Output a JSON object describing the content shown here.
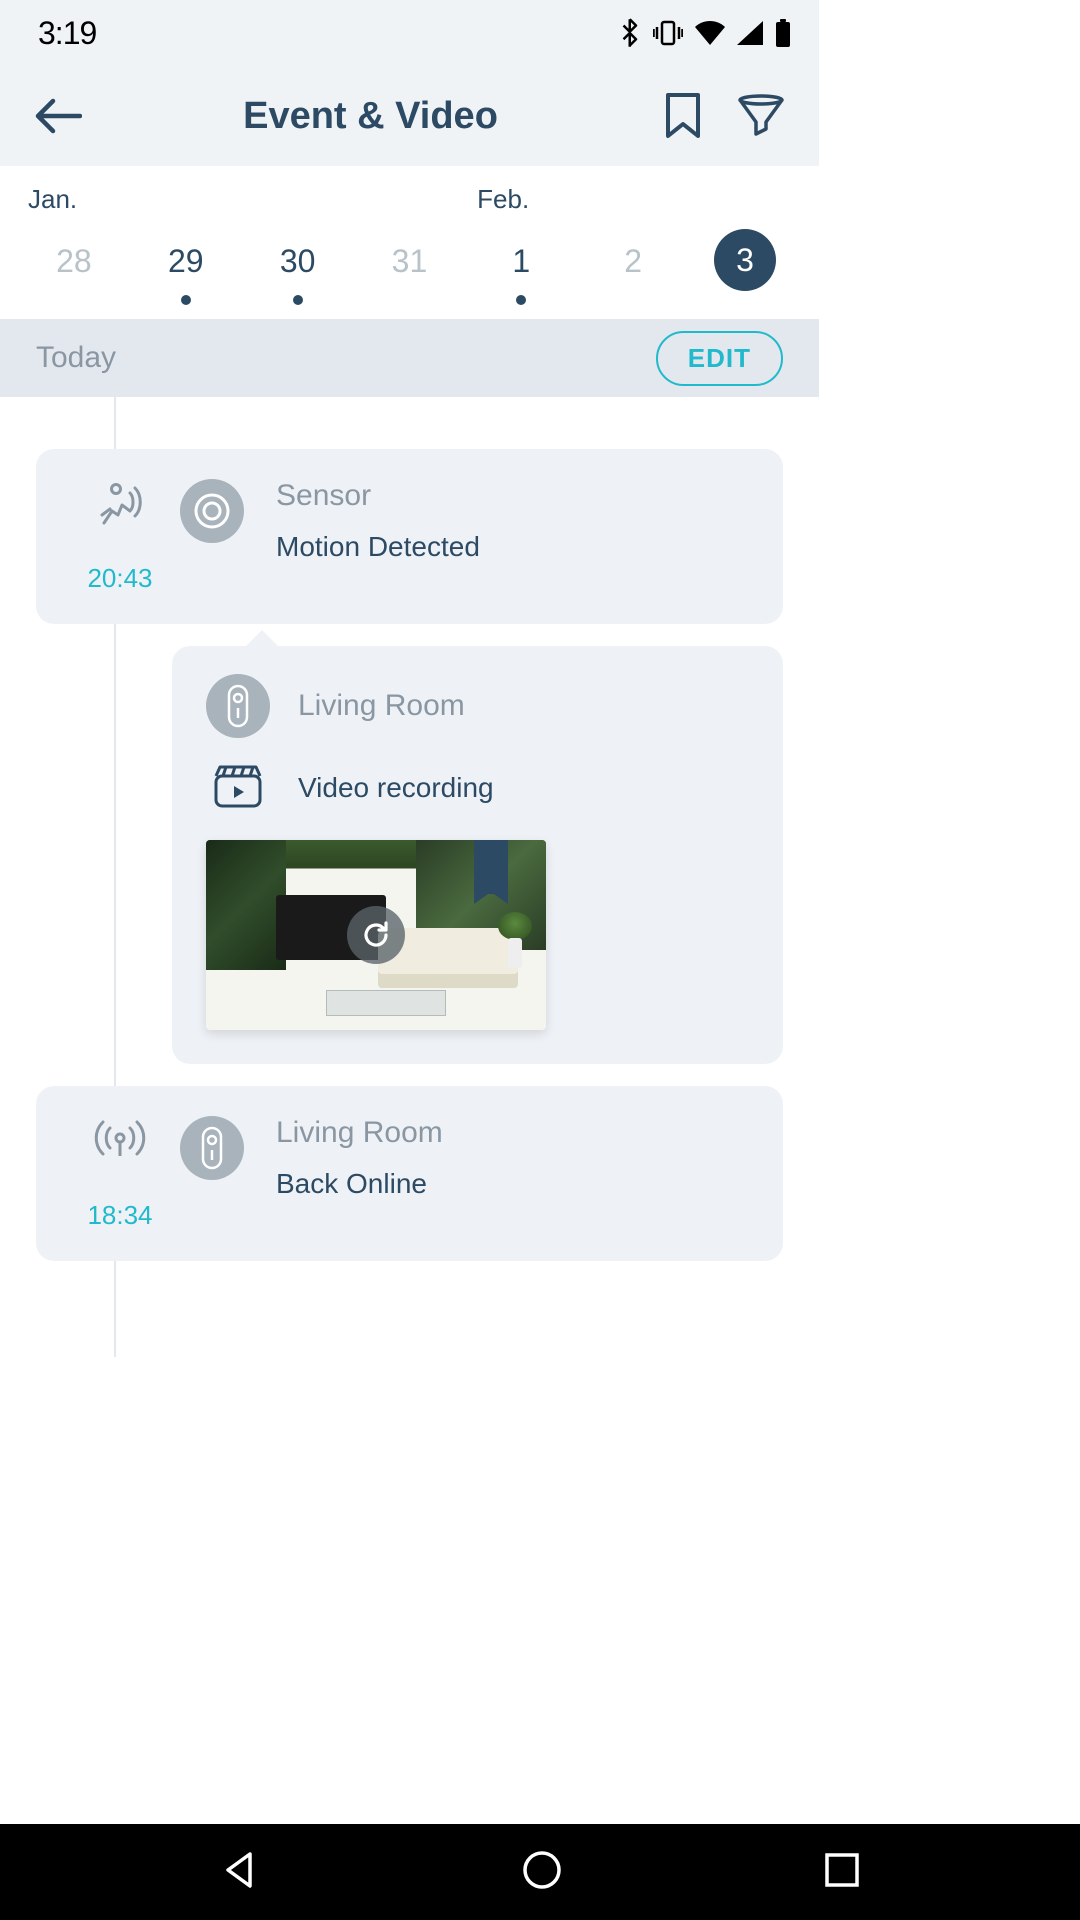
{
  "statusbar": {
    "time": "3:19"
  },
  "header": {
    "title": "Event & Video"
  },
  "calendar": {
    "months": [
      "Jan.",
      "Feb."
    ],
    "days": [
      {
        "num": "28",
        "faded": true,
        "dot": false,
        "selected": false
      },
      {
        "num": "29",
        "faded": false,
        "dot": true,
        "selected": false
      },
      {
        "num": "30",
        "faded": false,
        "dot": true,
        "selected": false
      },
      {
        "num": "31",
        "faded": true,
        "dot": false,
        "selected": false
      },
      {
        "num": "1",
        "faded": false,
        "dot": true,
        "selected": false
      },
      {
        "num": "2",
        "faded": true,
        "dot": false,
        "selected": false
      },
      {
        "num": "3",
        "faded": false,
        "dot": false,
        "selected": true
      }
    ]
  },
  "section": {
    "title": "Today",
    "edit": "EDIT"
  },
  "events": [
    {
      "kind": "motion",
      "time": "20:43",
      "source": "Sensor",
      "message": "Motion Detected",
      "attachment": {
        "source": "Living Room",
        "action": "Video recording"
      }
    },
    {
      "kind": "online",
      "time": "18:34",
      "source": "Living Room",
      "message": "Back Online"
    }
  ]
}
